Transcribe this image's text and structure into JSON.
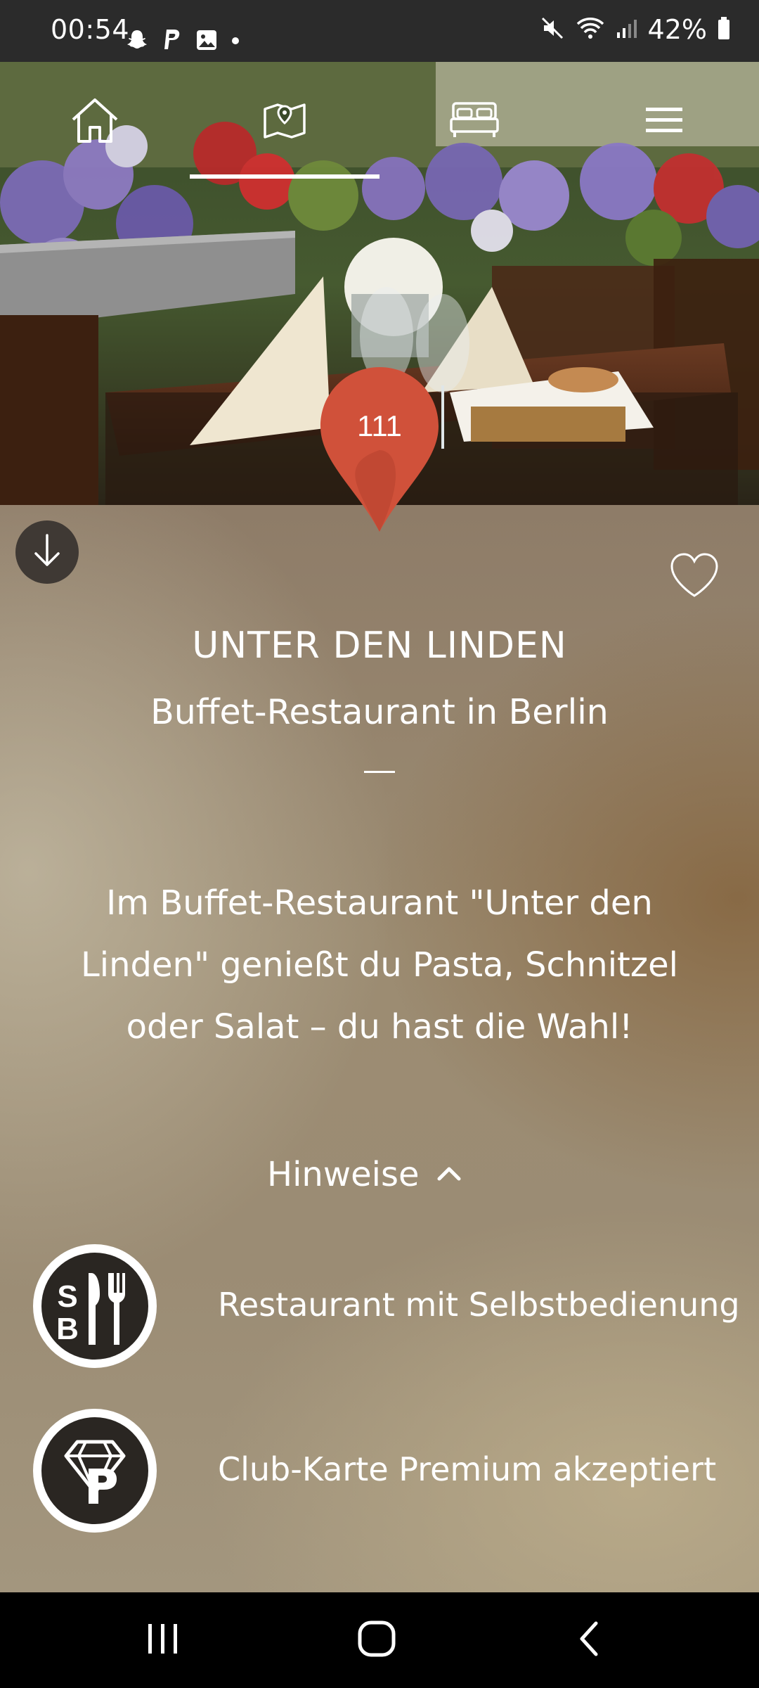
{
  "status_bar": {
    "time": "00:54",
    "battery": "42%",
    "left_icons": [
      "snapchat-icon",
      "paypal-icon",
      "gallery-icon",
      "dot-icon"
    ],
    "right_icons": [
      "mute-icon",
      "wifi-icon",
      "signal-icon",
      "battery-icon"
    ]
  },
  "nav": {
    "items": [
      {
        "name": "home",
        "icon": "home-icon"
      },
      {
        "name": "map",
        "icon": "map-icon",
        "active": true
      },
      {
        "name": "hotel",
        "icon": "bed-icon"
      },
      {
        "name": "menu",
        "icon": "hamburger-icon"
      }
    ]
  },
  "pin": {
    "number": "111",
    "color": "#d0513a"
  },
  "venue": {
    "title": "UNTER DEN LINDEN",
    "subtitle": "Buffet-Restaurant in Berlin",
    "separator": "—",
    "description": "Im Buffet-Restaurant \"Unter den Linden\" genießt du Pasta, Schnitzel oder Salat – du hast die Wahl!"
  },
  "hints": {
    "label": "Hinweise",
    "items": [
      {
        "icon": "self-service-icon",
        "text": "Restaurant mit Selbstbedienung"
      },
      {
        "icon": "club-card-premium-icon",
        "text": "Club-Karte Premium akzeptiert"
      }
    ]
  },
  "system_nav": {
    "icons": [
      "recent-apps-icon",
      "home-circle-icon",
      "back-icon"
    ]
  }
}
